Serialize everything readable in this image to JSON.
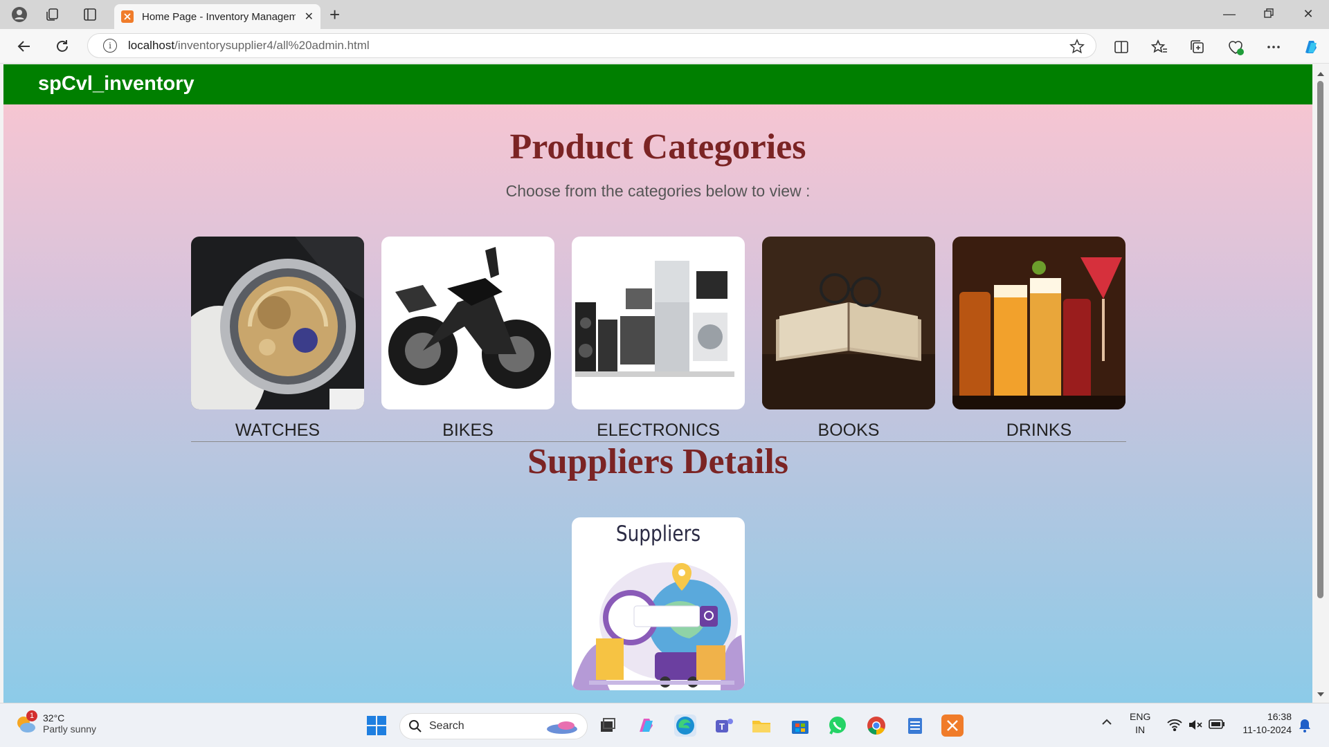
{
  "browser": {
    "tab_title": "Home Page - Inventory Managem",
    "url_host": "localhost",
    "url_path": "/inventorysupplier4/all%20admin.html"
  },
  "page": {
    "brand": "spCvl_inventory",
    "heading": "Product Categories",
    "subtitle": "Choose from the categories below to view :",
    "categories": [
      {
        "label": "WATCHES",
        "icon": "watch-image"
      },
      {
        "label": "BIKES",
        "icon": "bike-image"
      },
      {
        "label": "ELECTRONICS",
        "icon": "electronics-image"
      },
      {
        "label": "BOOKS",
        "icon": "book-image"
      },
      {
        "label": "DRINKS",
        "icon": "drinks-image"
      }
    ],
    "suppliers_heading": "Suppliers Details",
    "suppliers_card_title": "Suppliers",
    "colors": {
      "navbar": "#007f00",
      "heading": "#7b2424"
    }
  },
  "taskbar": {
    "weather_badge": "1",
    "temperature": "32°C",
    "condition": "Partly sunny",
    "search_label": "Search",
    "language": "ENG",
    "region": "IN",
    "time": "16:38",
    "date": "11-10-2024"
  }
}
